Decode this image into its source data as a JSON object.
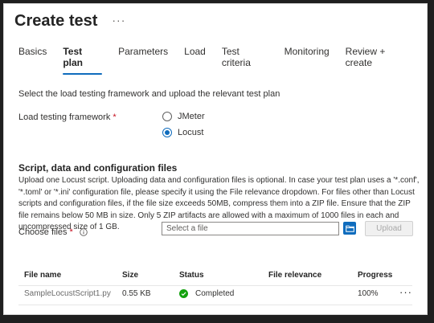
{
  "header": {
    "title": "Create test",
    "more_label": "···"
  },
  "tabs": [
    {
      "label": "Basics",
      "active": false
    },
    {
      "label": "Test plan",
      "active": true
    },
    {
      "label": "Parameters",
      "active": false
    },
    {
      "label": "Load",
      "active": false
    },
    {
      "label": "Test criteria",
      "active": false
    },
    {
      "label": "Monitoring",
      "active": false
    },
    {
      "label": "Review + create",
      "active": false
    }
  ],
  "intro_text": "Select the load testing framework and upload the relevant test plan",
  "framework": {
    "label": "Load testing framework",
    "required_mark": "*",
    "options": [
      {
        "label": "JMeter",
        "checked": false
      },
      {
        "label": "Locust",
        "checked": true
      }
    ]
  },
  "section": {
    "title": "Script, data and configuration files",
    "description": "Upload one Locust script. Uploading data and configuration files is optional. In case your test plan uses a '*.conf', '*.toml' or '*.ini' configuration file, please specify it using the File relevance dropdown. For files other than Locust scripts and configuration files, if the file size exceeds 50MB, compress them into a ZIP file. Ensure that the ZIP file remains below 50 MB in size. Only 5 ZIP artifacts are allowed with a maximum of 1000 files in each and uncompressed size of 1 GB."
  },
  "choose_files": {
    "label": "Choose files",
    "required_mark": "*",
    "placeholder": "Select a file",
    "upload_label": "Upload"
  },
  "table": {
    "headers": [
      "File name",
      "Size",
      "Status",
      "File relevance",
      "Progress"
    ],
    "rows": [
      {
        "file_name": "SampleLocustScript1.py",
        "size": "0.55 KB",
        "status": "Completed",
        "relevance": "",
        "progress": "100%",
        "more": "···"
      }
    ]
  },
  "colors": {
    "accent": "#0f6cbd",
    "success": "#13a10e",
    "required": "#c50f1f"
  }
}
